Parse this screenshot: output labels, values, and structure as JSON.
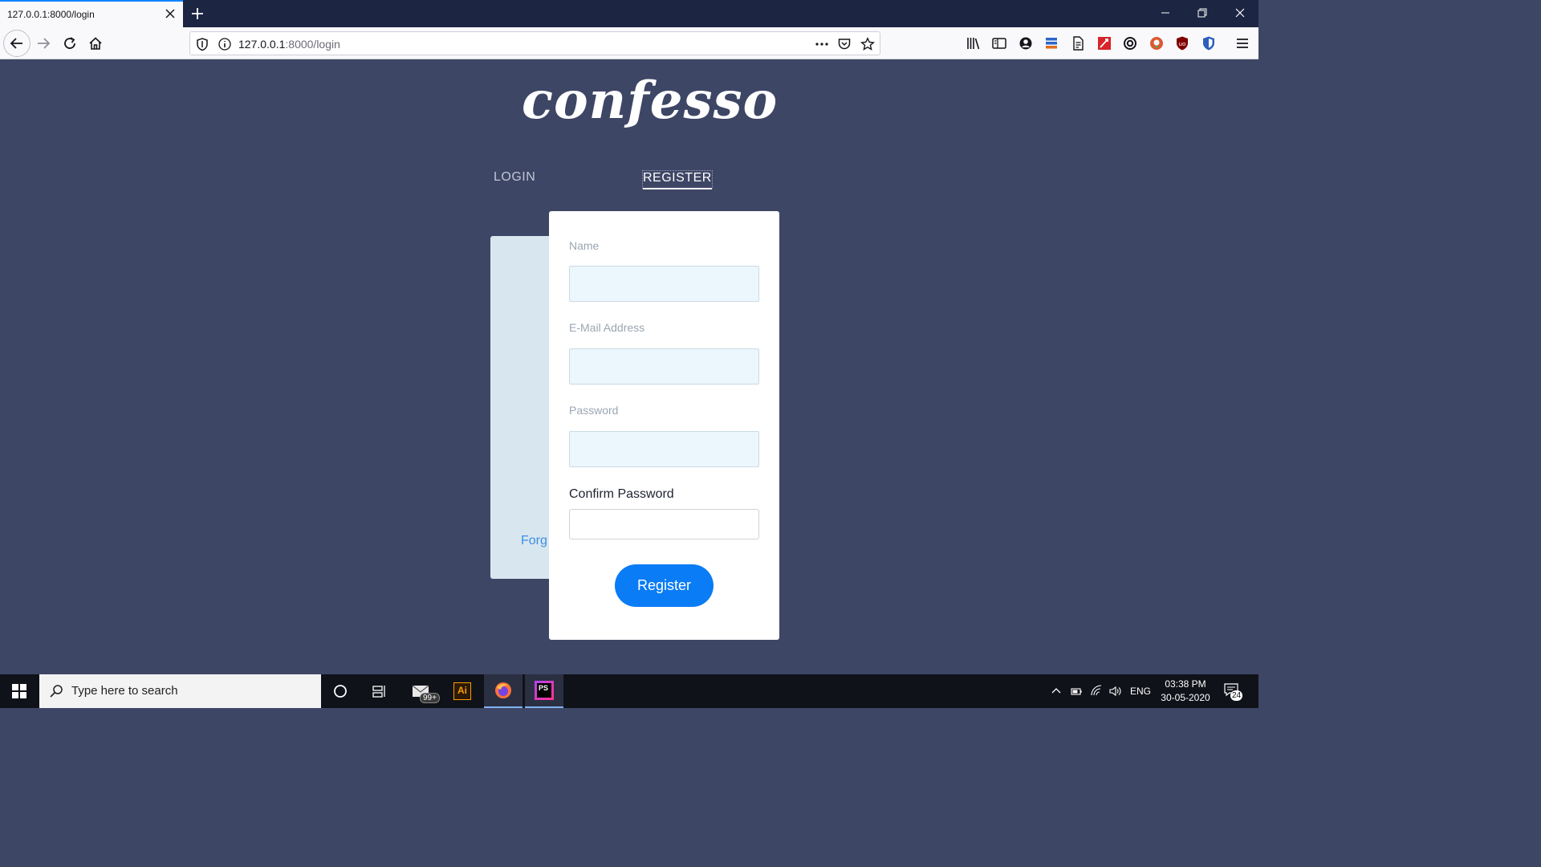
{
  "browser": {
    "tab_title": "127.0.0.1:8000/login",
    "url_host": "127.0.0.1",
    "url_path": ":8000/login"
  },
  "page": {
    "logo_text": "confesso",
    "tabs": [
      {
        "label": "LOGIN",
        "active": false
      },
      {
        "label": "REGISTER",
        "active": true
      }
    ],
    "back_card": {
      "forgot_text": "Forg"
    },
    "form": {
      "fields": [
        {
          "label": "Name",
          "value": ""
        },
        {
          "label": "E-Mail Address",
          "value": ""
        },
        {
          "label": "Password",
          "value": ""
        },
        {
          "label": "Confirm Password",
          "value": ""
        }
      ],
      "submit_label": "Register"
    }
  },
  "taskbar": {
    "search_placeholder": "Type here to search",
    "mail_badge": "99+",
    "ai_label": "Ai",
    "ps_label": "PS",
    "language": "ENG",
    "time": "03:38 PM",
    "date": "30-05-2020",
    "notification_count": "24"
  },
  "colors": {
    "page_bg": "#3e4665",
    "accent": "#0a7cf5",
    "card_bg": "#ffffff",
    "back_card_bg": "#d8e6f0"
  }
}
